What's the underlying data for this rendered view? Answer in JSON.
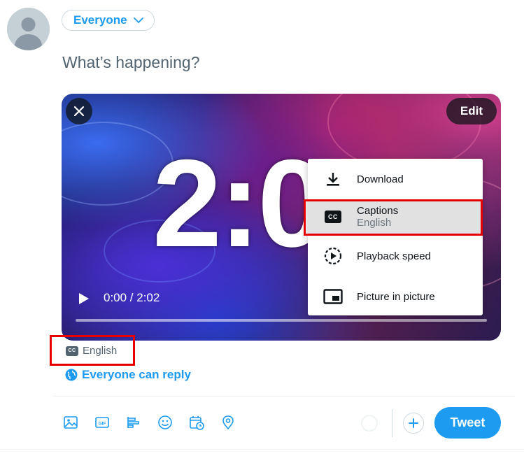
{
  "composer": {
    "audience_label": "Everyone",
    "prompt_placeholder": "What’s happening?",
    "reply_setting": "Everyone can reply",
    "tweet_button": "Tweet"
  },
  "media": {
    "overlay_number": "2:0",
    "edit_label": "Edit",
    "time_display": "0:00 / 2:02",
    "progress": 0
  },
  "settings_menu": {
    "items": [
      {
        "label": "Download",
        "icon": "download-icon"
      },
      {
        "label": "Captions",
        "sublabel": "English",
        "icon": "cc-icon"
      },
      {
        "label": "Playback speed",
        "icon": "playback-speed-icon"
      },
      {
        "label": "Picture in picture",
        "icon": "pip-icon"
      }
    ],
    "cc_glyph": "CC"
  },
  "caption_tag": {
    "label": "English",
    "cc_glyph": "CC"
  },
  "colors": {
    "accent": "#1d9bf0",
    "highlight": "#e60000",
    "text_secondary": "#536471"
  },
  "toolbar": {
    "icons": [
      "image-icon",
      "gif-icon",
      "poll-icon",
      "emoji-icon",
      "schedule-icon",
      "location-icon"
    ]
  }
}
